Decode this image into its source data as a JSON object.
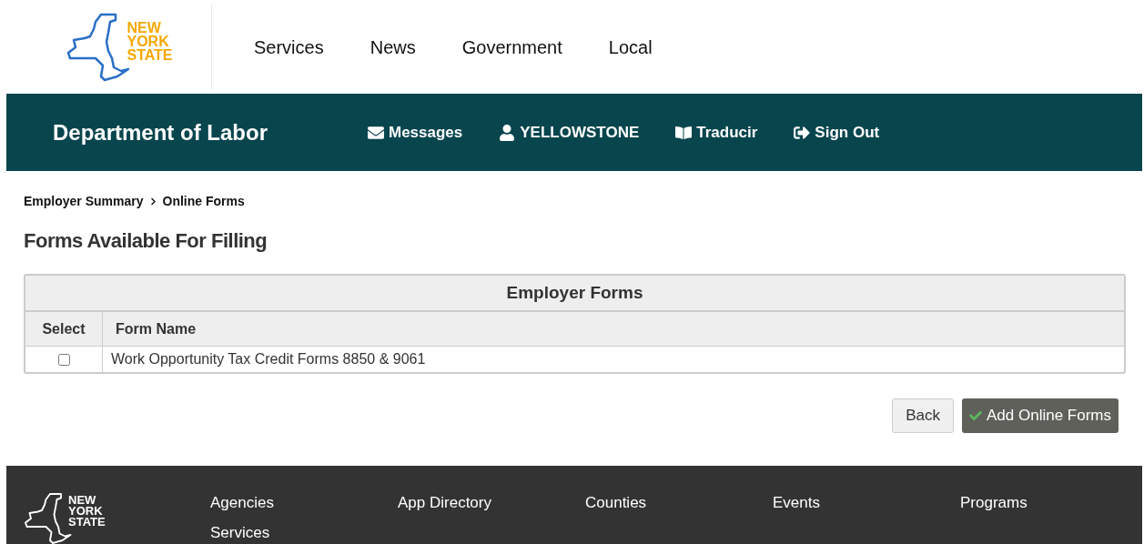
{
  "logo": {
    "lines": [
      "NEW",
      "YORK",
      "STATE"
    ]
  },
  "top_nav": [
    "Services",
    "News",
    "Government",
    "Local"
  ],
  "department_bar": {
    "title": "Department of Labor",
    "links": [
      {
        "kind": "messages",
        "label": "Messages"
      },
      {
        "kind": "user",
        "label": "YELLOWSTONE"
      },
      {
        "kind": "translate",
        "label": "Traducir"
      },
      {
        "kind": "signout",
        "label": "Sign Out"
      }
    ]
  },
  "breadcrumb": [
    "Employer Summary",
    "Online Forms"
  ],
  "heading": "Forms Available For Filling",
  "table": {
    "title": "Employer Forms",
    "columns": [
      "Select",
      "Form Name"
    ],
    "rows": [
      {
        "checked": false,
        "form_name": "Work Opportunity Tax Credit Forms 8850 & 9061"
      }
    ]
  },
  "buttons": [
    {
      "kind": "back",
      "label": "Back"
    },
    {
      "kind": "primary",
      "label": "Add Online Forms"
    }
  ],
  "footer": {
    "logo_lines": [
      "NEW",
      "YORK",
      "STATE"
    ],
    "columns": [
      [
        "Agencies",
        "Services"
      ],
      [
        "App Directory"
      ],
      [
        "Counties"
      ],
      [
        "Events"
      ],
      [
        "Programs"
      ]
    ]
  }
}
